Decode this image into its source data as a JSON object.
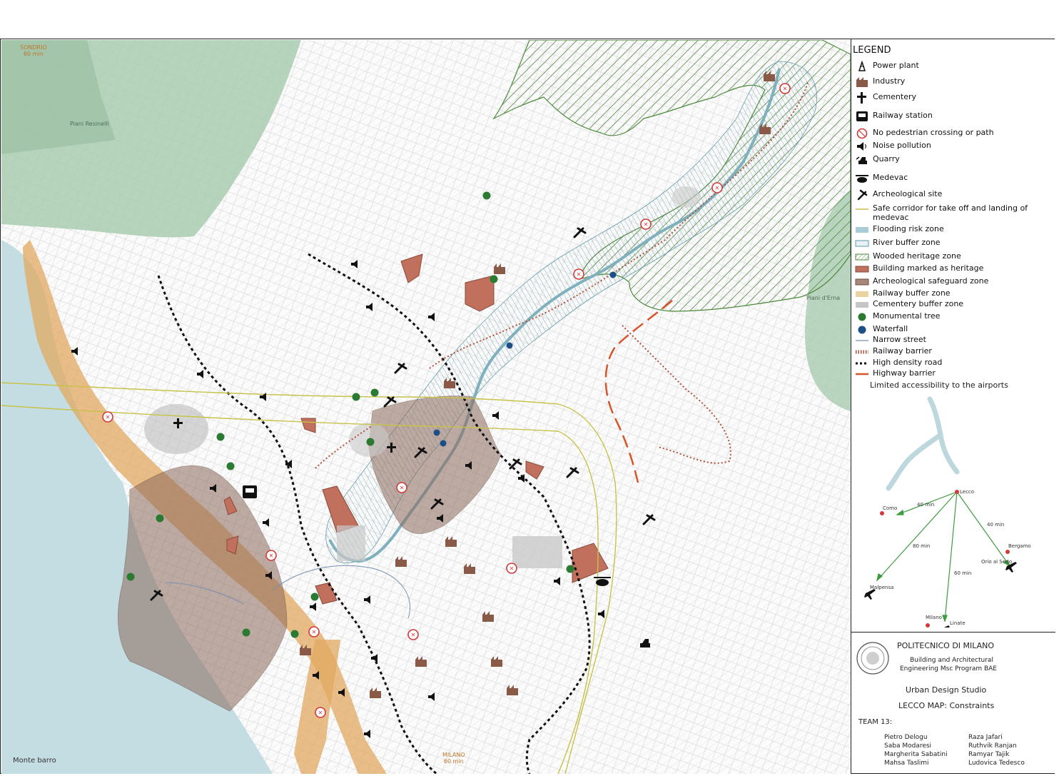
{
  "map": {
    "place_labels": {
      "sondrio": "SONDRIO",
      "sondrio_time": "60 min",
      "piani_resinelli": "Piani Resinelli",
      "piani_erna": "Piani d'Erna",
      "monte_barro": "Monte barro",
      "milano": "MILANO",
      "milano_time": "60 min"
    },
    "colors": {
      "lake": "#c4dde3",
      "mountain_green": "#a9cbb0",
      "archeo_zone": "#8c6a5c",
      "heritage_building": "#c0705c",
      "wooded_hatch": "#4d8a3c",
      "flood_hatch": "#5d97a6",
      "railway_buffer": "#e2a860",
      "monumental_tree": "#2a7a32",
      "waterfall": "#1c4f86",
      "highway_barrier": "#d6552a",
      "safe_corridor": "#c8c24a"
    }
  },
  "legend": {
    "title": "LEGEND",
    "items": [
      {
        "label": "Power plant",
        "icon": "power-plant-icon"
      },
      {
        "label": "Industry",
        "icon": "industry-icon"
      },
      {
        "label": "Cementery",
        "icon": "cemetery-cross-icon"
      },
      {
        "label": "Railway station",
        "icon": "railway-station-icon"
      },
      {
        "label": "No pedestrian crossing or path",
        "icon": "no-pedestrian-icon"
      },
      {
        "label": "Noise pollution",
        "icon": "noise-speaker-icon"
      },
      {
        "label": "Quarry",
        "icon": "quarry-excavator-icon"
      },
      {
        "label": "Medevac",
        "icon": "helicopter-icon"
      },
      {
        "label": "Archeological site",
        "icon": "pickaxe-icon"
      },
      {
        "label": "Safe corridor for take off and landing of medevac",
        "icon": "yellow-line"
      },
      {
        "label": "Flooding risk zone",
        "icon": "light-blue-fill"
      },
      {
        "label": "River buffer zone",
        "icon": "blue-outline-fill"
      },
      {
        "label": "Wooded heritage zone",
        "icon": "green-hatch"
      },
      {
        "label": "Building marked as heritage",
        "icon": "red-brown-fill"
      },
      {
        "label": "Archeological safeguard zone",
        "icon": "brown-fill"
      },
      {
        "label": "Railway buffer zone",
        "icon": "tan-fill"
      },
      {
        "label": "Cementery buffer zone",
        "icon": "grey-fill"
      },
      {
        "label": "Monumental tree",
        "icon": "green-dot"
      },
      {
        "label": "Waterfall",
        "icon": "blue-dot"
      },
      {
        "label": "Narrow street",
        "icon": "thin-blue-line"
      },
      {
        "label": "Railway barrier",
        "icon": "red-dotted-line"
      },
      {
        "label": "High density road",
        "icon": "black-dashed-line"
      },
      {
        "label": "Highway barrier",
        "icon": "orange-line"
      }
    ],
    "airport_heading": "Limited accessibility to the airports"
  },
  "inset": {
    "cities": {
      "lecco": "Lecco",
      "como": "Como",
      "bergamo": "Bergamo",
      "malpensa": "Malpensa",
      "milano": "Milano",
      "linate": "Linate",
      "orio": "Orio al Serio"
    },
    "times": {
      "como": "40 min",
      "bergamo": "40 min",
      "malpensa": "80 min",
      "linate": "60 min"
    }
  },
  "title_block": {
    "university": "POLITECNICO DI MILANO",
    "program_line1": "Building and Architectural",
    "program_line2": "Engineering Msc Program BAE",
    "studio": "Urban Design Studio",
    "map_title_prefix": "LECCO MAP:",
    "map_title_suffix": "Constraints",
    "team_label": "TEAM 13:",
    "members_left": [
      "Pietro Delogu",
      "Saba Modaresi",
      "Margherita Sabatini",
      "Mahsa Taslimi"
    ],
    "members_right": [
      "Raza Jafari",
      "Ruthvik Ranjan",
      "Ramyar Tajik",
      "Ludovica Tedesco"
    ]
  }
}
